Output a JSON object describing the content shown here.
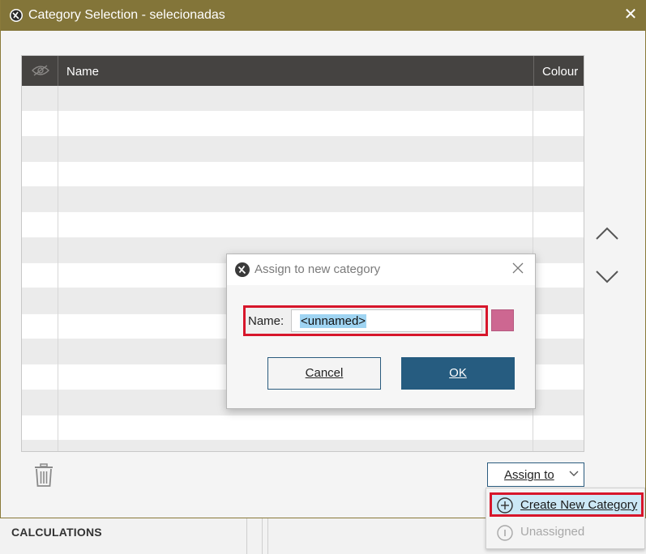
{
  "window": {
    "title": "Category Selection - selecionadas",
    "close_glyph": "✕"
  },
  "table": {
    "columns": [
      "Name",
      "Colour"
    ],
    "visibility_icon": "eye-hidden-icon",
    "row_count": 14
  },
  "toolbar": {
    "assign_label": "Assign to"
  },
  "menu": {
    "items": [
      {
        "label": "Create New Category",
        "icon": "plus-circle-icon",
        "enabled": true
      },
      {
        "label": "Unassigned",
        "icon": "info-circle-icon",
        "enabled": false
      }
    ]
  },
  "background": {
    "panel_label": "CALCULATIONS"
  },
  "dialog": {
    "title": "Assign to new category",
    "name_label": "Name:",
    "name_value": "<unnamed>",
    "swatch_color": "#cd6791",
    "cancel_label": "Cancel",
    "ok_label": "OK"
  },
  "colors": {
    "titlebar": "#837539",
    "header": "#454341",
    "ok_button": "#265c80",
    "highlight": "#d7162b"
  }
}
